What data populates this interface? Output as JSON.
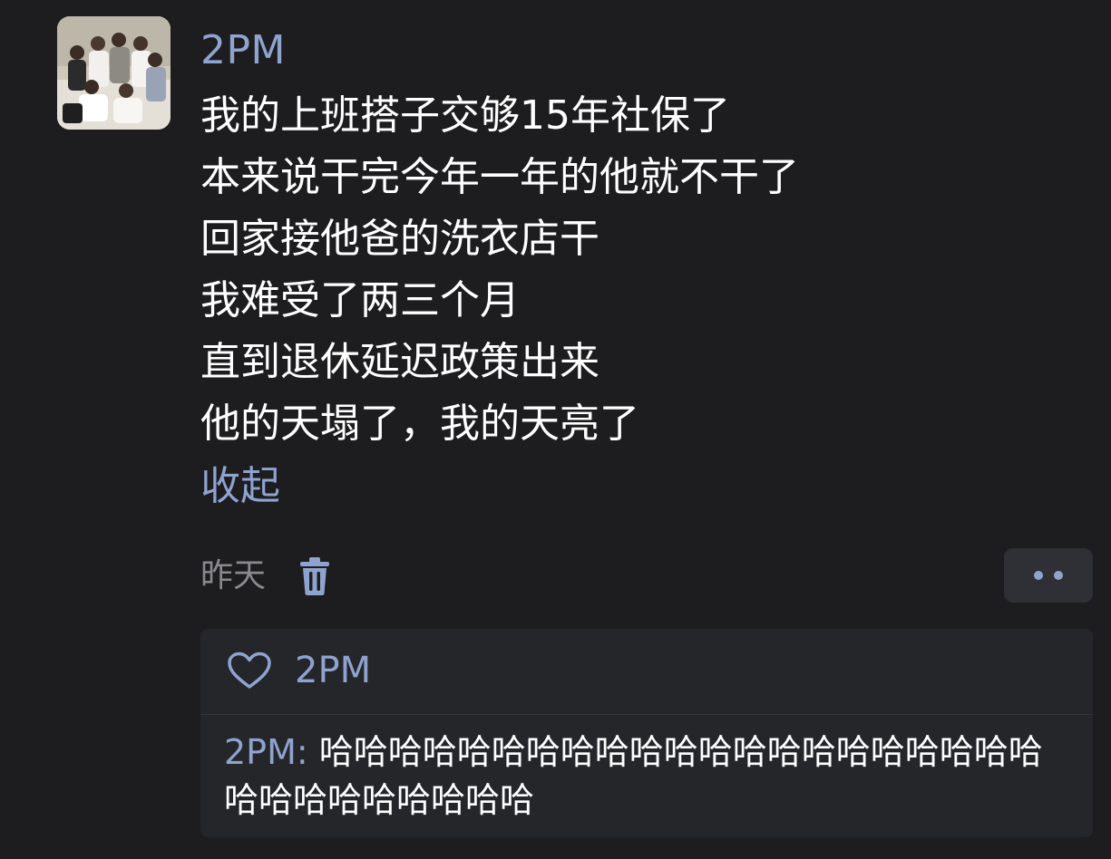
{
  "post": {
    "username": "2PM",
    "lines": [
      "我的上班搭子交够15年社保了",
      "本来说干完今年一年的他就不干了",
      "回家接他爸的洗衣店干",
      "我难受了两三个月",
      "直到退休延迟政策出来",
      "他的天塌了，我的天亮了"
    ],
    "collapse_label": "收起",
    "timestamp": "昨天"
  },
  "likes": {
    "names": "2PM"
  },
  "comment": {
    "author": "2PM:",
    "text": "哈哈哈哈哈哈哈哈哈哈哈哈哈哈哈哈哈哈哈哈哈哈哈哈哈哈哈哈哈哈"
  },
  "colors": {
    "background": "#1d1d1f",
    "accent": "#8fa3cf",
    "panel": "#25262a"
  },
  "icons": {
    "delete": "trash-icon",
    "more": "more-icon",
    "like": "heart-icon"
  }
}
